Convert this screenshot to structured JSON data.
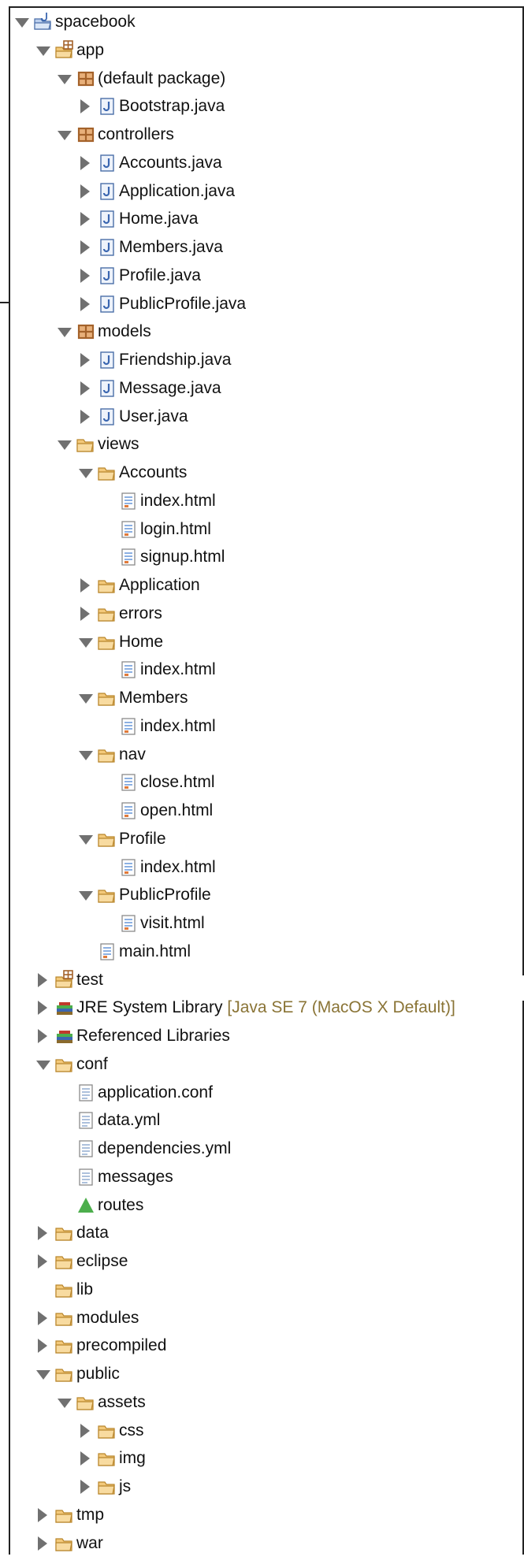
{
  "tree": [
    {
      "label": "spacebook",
      "decoration": "",
      "icon": "project-folder-icon",
      "depth": 0,
      "state": "open"
    },
    {
      "label": "app",
      "decoration": "",
      "icon": "source-folder-icon",
      "depth": 1,
      "state": "open"
    },
    {
      "label": "(default package)",
      "decoration": "",
      "icon": "package-icon",
      "depth": 2,
      "state": "open"
    },
    {
      "label": "Bootstrap.java",
      "decoration": "",
      "icon": "java-file-icon",
      "depth": 3,
      "state": "closed"
    },
    {
      "label": "controllers",
      "decoration": "",
      "icon": "package-icon",
      "depth": 2,
      "state": "open"
    },
    {
      "label": "Accounts.java",
      "decoration": "",
      "icon": "java-file-icon",
      "depth": 3,
      "state": "closed"
    },
    {
      "label": "Application.java",
      "decoration": "",
      "icon": "java-file-icon",
      "depth": 3,
      "state": "closed"
    },
    {
      "label": "Home.java",
      "decoration": "",
      "icon": "java-file-icon",
      "depth": 3,
      "state": "closed"
    },
    {
      "label": "Members.java",
      "decoration": "",
      "icon": "java-file-icon",
      "depth": 3,
      "state": "closed"
    },
    {
      "label": "Profile.java",
      "decoration": "",
      "icon": "java-file-icon",
      "depth": 3,
      "state": "closed"
    },
    {
      "label": "PublicProfile.java",
      "decoration": "",
      "icon": "java-file-icon",
      "depth": 3,
      "state": "closed"
    },
    {
      "label": "models",
      "decoration": "",
      "icon": "package-icon",
      "depth": 2,
      "state": "open"
    },
    {
      "label": "Friendship.java",
      "decoration": "",
      "icon": "java-file-icon",
      "depth": 3,
      "state": "closed"
    },
    {
      "label": "Message.java",
      "decoration": "",
      "icon": "java-file-icon",
      "depth": 3,
      "state": "closed"
    },
    {
      "label": "User.java",
      "decoration": "",
      "icon": "java-file-icon",
      "depth": 3,
      "state": "closed"
    },
    {
      "label": "views",
      "decoration": "",
      "icon": "folder-icon",
      "depth": 2,
      "state": "open"
    },
    {
      "label": "Accounts",
      "decoration": "",
      "icon": "folder-icon",
      "depth": 3,
      "state": "open"
    },
    {
      "label": "index.html",
      "decoration": "",
      "icon": "html-file-icon",
      "depth": 4,
      "state": "leaf"
    },
    {
      "label": "login.html",
      "decoration": "",
      "icon": "html-file-icon",
      "depth": 4,
      "state": "leaf"
    },
    {
      "label": "signup.html",
      "decoration": "",
      "icon": "html-file-icon",
      "depth": 4,
      "state": "leaf"
    },
    {
      "label": "Application",
      "decoration": "",
      "icon": "folder-icon",
      "depth": 3,
      "state": "closed"
    },
    {
      "label": "errors",
      "decoration": "",
      "icon": "folder-icon",
      "depth": 3,
      "state": "closed"
    },
    {
      "label": "Home",
      "decoration": "",
      "icon": "folder-icon",
      "depth": 3,
      "state": "open"
    },
    {
      "label": "index.html",
      "decoration": "",
      "icon": "html-file-icon",
      "depth": 4,
      "state": "leaf"
    },
    {
      "label": "Members",
      "decoration": "",
      "icon": "folder-icon",
      "depth": 3,
      "state": "open"
    },
    {
      "label": "index.html",
      "decoration": "",
      "icon": "html-file-icon",
      "depth": 4,
      "state": "leaf"
    },
    {
      "label": "nav",
      "decoration": "",
      "icon": "folder-icon",
      "depth": 3,
      "state": "open"
    },
    {
      "label": "close.html",
      "decoration": "",
      "icon": "html-file-icon",
      "depth": 4,
      "state": "leaf"
    },
    {
      "label": "open.html",
      "decoration": "",
      "icon": "html-file-icon",
      "depth": 4,
      "state": "leaf"
    },
    {
      "label": "Profile",
      "decoration": "",
      "icon": "folder-icon",
      "depth": 3,
      "state": "open"
    },
    {
      "label": "index.html",
      "decoration": "",
      "icon": "html-file-icon",
      "depth": 4,
      "state": "leaf"
    },
    {
      "label": "PublicProfile",
      "decoration": "",
      "icon": "folder-icon",
      "depth": 3,
      "state": "open"
    },
    {
      "label": "visit.html",
      "decoration": "",
      "icon": "html-file-icon",
      "depth": 4,
      "state": "leaf"
    },
    {
      "label": "main.html",
      "decoration": "",
      "icon": "html-file-icon",
      "depth": 3,
      "state": "leaf"
    },
    {
      "label": "test",
      "decoration": "",
      "icon": "source-folder-icon",
      "depth": 1,
      "state": "closed"
    },
    {
      "label": "JRE System Library",
      "decoration": "[Java SE 7 (MacOS X Default)]",
      "icon": "library-icon",
      "depth": 1,
      "state": "closed"
    },
    {
      "label": "Referenced Libraries",
      "decoration": "",
      "icon": "library-icon",
      "depth": 1,
      "state": "closed"
    },
    {
      "label": "conf",
      "decoration": "",
      "icon": "folder-icon",
      "depth": 1,
      "state": "open"
    },
    {
      "label": "application.conf",
      "decoration": "",
      "icon": "text-file-icon",
      "depth": 2,
      "state": "leaf"
    },
    {
      "label": "data.yml",
      "decoration": "",
      "icon": "text-file-icon",
      "depth": 2,
      "state": "leaf"
    },
    {
      "label": "dependencies.yml",
      "decoration": "",
      "icon": "text-file-icon",
      "depth": 2,
      "state": "leaf"
    },
    {
      "label": "messages",
      "decoration": "",
      "icon": "text-file-icon",
      "depth": 2,
      "state": "leaf"
    },
    {
      "label": "routes",
      "decoration": "",
      "icon": "routes-icon",
      "depth": 2,
      "state": "leaf"
    },
    {
      "label": "data",
      "decoration": "",
      "icon": "folder-icon",
      "depth": 1,
      "state": "closed"
    },
    {
      "label": "eclipse",
      "decoration": "",
      "icon": "folder-icon",
      "depth": 1,
      "state": "closed"
    },
    {
      "label": "lib",
      "decoration": "",
      "icon": "folder-icon",
      "depth": 1,
      "state": "leaf"
    },
    {
      "label": "modules",
      "decoration": "",
      "icon": "folder-icon",
      "depth": 1,
      "state": "closed"
    },
    {
      "label": "precompiled",
      "decoration": "",
      "icon": "folder-icon",
      "depth": 1,
      "state": "closed"
    },
    {
      "label": "public",
      "decoration": "",
      "icon": "folder-icon",
      "depth": 1,
      "state": "open"
    },
    {
      "label": "assets",
      "decoration": "",
      "icon": "folder-icon",
      "depth": 2,
      "state": "open"
    },
    {
      "label": "css",
      "decoration": "",
      "icon": "folder-icon",
      "depth": 3,
      "state": "closed"
    },
    {
      "label": "img",
      "decoration": "",
      "icon": "folder-icon",
      "depth": 3,
      "state": "closed"
    },
    {
      "label": "js",
      "decoration": "",
      "icon": "folder-icon",
      "depth": 3,
      "state": "closed"
    },
    {
      "label": "tmp",
      "decoration": "",
      "icon": "folder-icon",
      "depth": 1,
      "state": "closed"
    },
    {
      "label": "war",
      "decoration": "",
      "icon": "folder-icon",
      "depth": 1,
      "state": "closed"
    }
  ],
  "colors": {
    "folder": "#f3c97a",
    "folder_stroke": "#b9862c",
    "package": "#a4622a",
    "java_badge": "#3a66b0",
    "decoration": "#8a7436",
    "routes": "#4cae4c"
  }
}
